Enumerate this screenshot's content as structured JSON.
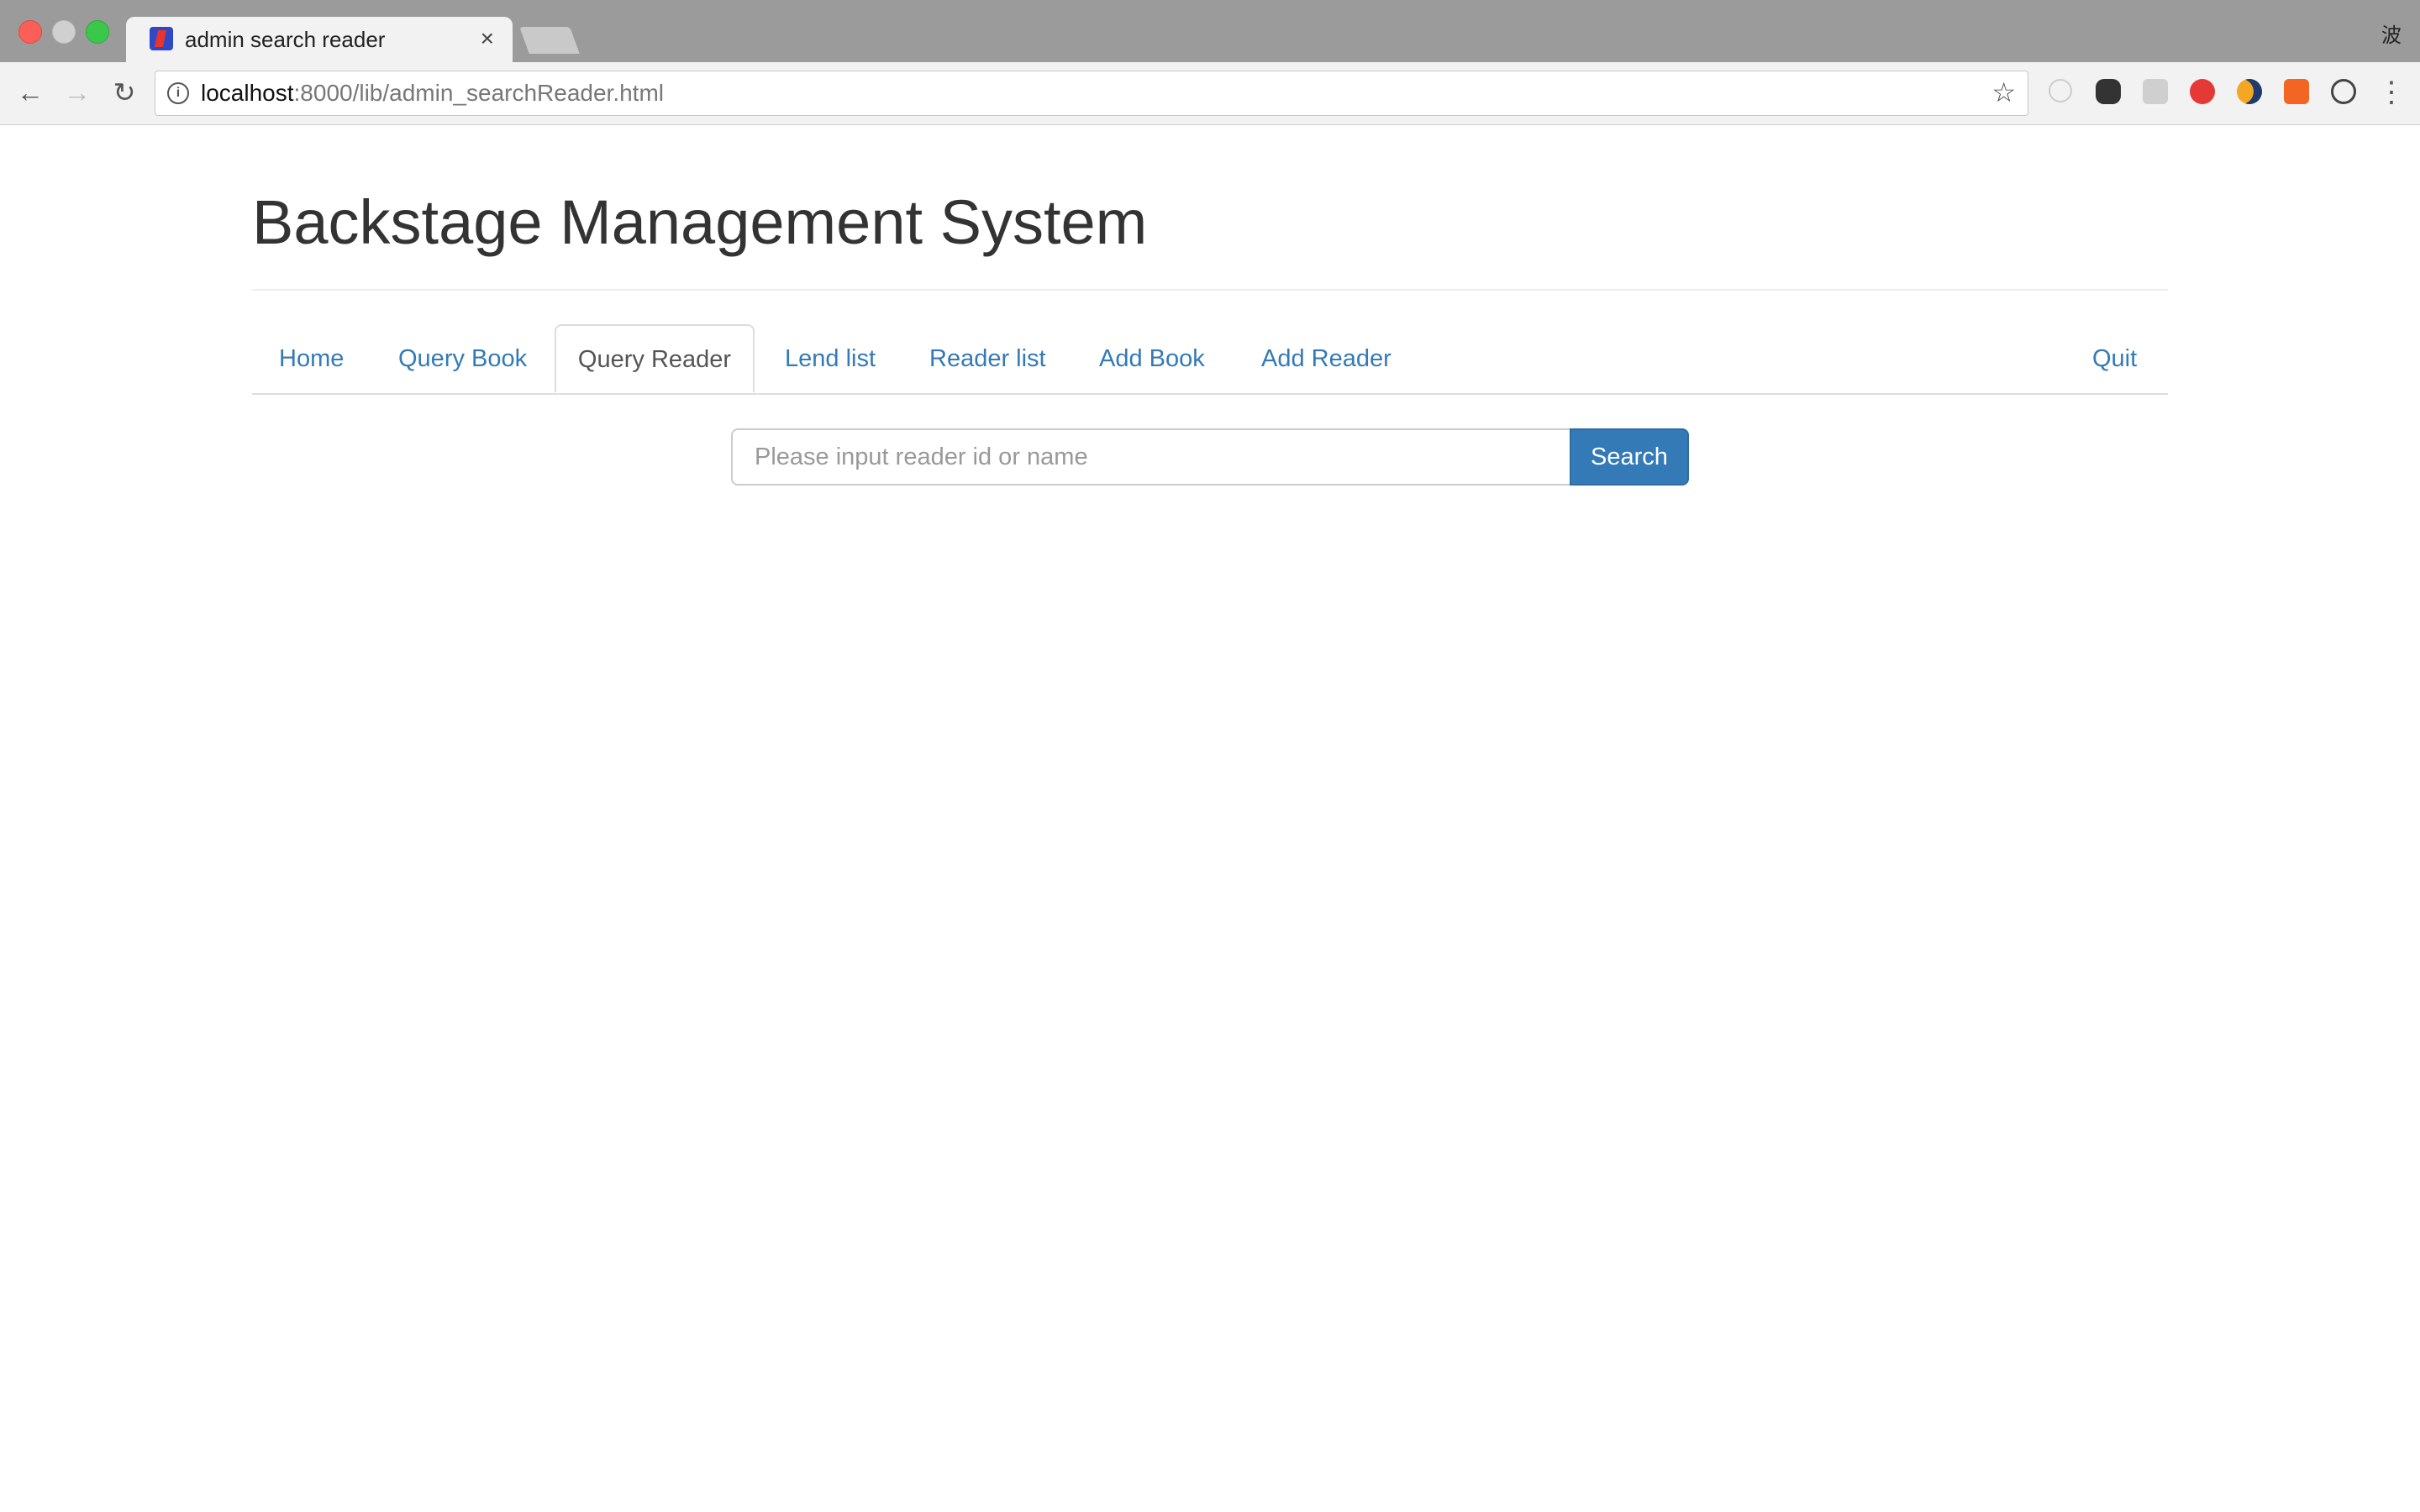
{
  "browser": {
    "tab_title": "admin search reader",
    "tab_close": "×",
    "profile_glyph": "波",
    "url_host": "localhost",
    "url_path": ":8000/lib/admin_searchReader.html",
    "back_icon": "←",
    "forward_icon": "→",
    "reload_icon": "↻",
    "star_icon": "☆",
    "menu_icon": "⋮"
  },
  "page": {
    "title": "Backstage Management System"
  },
  "nav": {
    "home": "Home",
    "query_book": "Query Book",
    "query_reader": "Query Reader",
    "lend_list": "Lend list",
    "reader_list": "Reader list",
    "add_book": "Add Book",
    "add_reader": "Add Reader",
    "quit": "Quit",
    "active": "Query Reader"
  },
  "search": {
    "placeholder": "Please input reader id or name",
    "button_label": "Search"
  },
  "colors": {
    "link": "#337ab7",
    "button_bg": "#337ab7"
  }
}
